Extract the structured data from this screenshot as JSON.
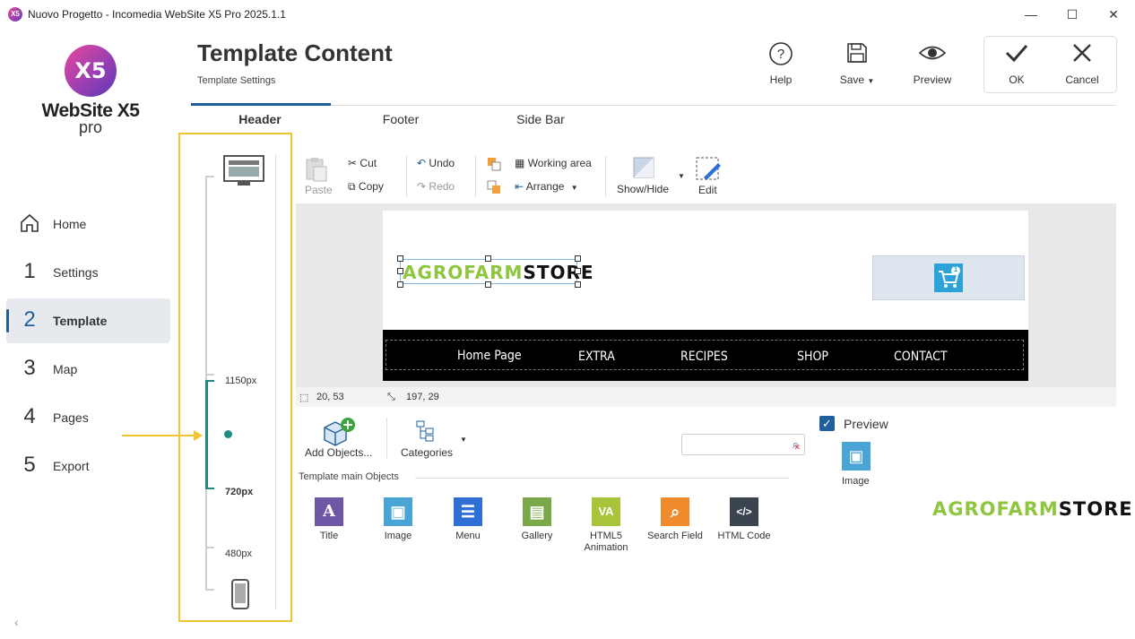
{
  "window": {
    "title": "Nuovo Progetto - Incomedia WebSite X5 Pro 2025.1.1",
    "app_icon_text": "X5",
    "minimize": "—",
    "maximize": "☐",
    "close": "✕"
  },
  "brand": {
    "logo_text": "X5",
    "name": "WebSite X5",
    "edition": "pro"
  },
  "nav": {
    "items": [
      {
        "num": "",
        "label": "Home",
        "icon": "home-icon"
      },
      {
        "num": "1",
        "label": "Settings"
      },
      {
        "num": "2",
        "label": "Template"
      },
      {
        "num": "3",
        "label": "Map"
      },
      {
        "num": "4",
        "label": "Pages"
      },
      {
        "num": "5",
        "label": "Export"
      }
    ],
    "active": "Template"
  },
  "header": {
    "title": "Template Content",
    "subtitle": "Template Settings",
    "buttons": {
      "help": "Help",
      "save": "Save",
      "preview": "Preview",
      "ok": "OK",
      "cancel": "Cancel"
    }
  },
  "tabs": {
    "header": "Header",
    "footer": "Footer",
    "sidebar": "Side Bar",
    "active": "Header"
  },
  "breakpoints": {
    "labels": [
      "1150px",
      "720px",
      "480px"
    ],
    "active": "720px"
  },
  "toolbar": {
    "paste": "Paste",
    "cut": "Cut",
    "copy": "Copy",
    "undo": "Undo",
    "redo": "Redo",
    "working_area": "Working area",
    "arrange": "Arrange",
    "show_hide": "Show/Hide",
    "edit": "Edit"
  },
  "canvas": {
    "logo": {
      "green": "AGROFARM",
      "black": "STORE"
    },
    "cart_badge": "1",
    "menu": [
      "Home Page",
      "EXTRA",
      "RECIPES",
      "SHOP",
      "CONTACT"
    ],
    "position": "20, 53",
    "size": "197, 29"
  },
  "objects_panel": {
    "add_objects": "Add Objects...",
    "categories": "Categories",
    "section_title": "Template main Objects",
    "search_placeholder": "",
    "items": [
      {
        "label": "Title",
        "glyph": "A",
        "color": "#6e57a5"
      },
      {
        "label": "Image",
        "glyph": "▣",
        "color": "#4aa5d6"
      },
      {
        "label": "Menu",
        "glyph": "☰",
        "color": "#2f6fd6"
      },
      {
        "label": "Gallery",
        "glyph": "▤",
        "color": "#7ba84a"
      },
      {
        "label": "HTML5\nAnimation",
        "glyph": "VA",
        "color": "#a8c43a"
      },
      {
        "label": "Search Field",
        "glyph": "⌕",
        "color": "#ef8b2c"
      },
      {
        "label": "HTML Code",
        "glyph": "</>",
        "color": "#3a4550"
      }
    ]
  },
  "preview_panel": {
    "label": "Preview",
    "checked": true,
    "image_label": "Image",
    "logo": {
      "green": "AGROFARM",
      "black": "STORE"
    }
  },
  "footer": {
    "collapse": "‹"
  }
}
